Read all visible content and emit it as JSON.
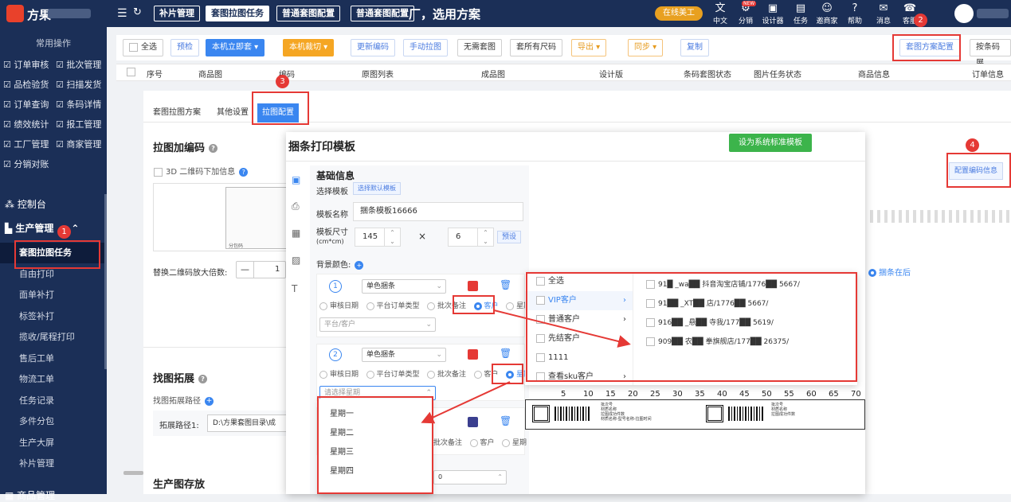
{
  "topbar": {
    "brand": "方果",
    "tabs": [
      "补片管理",
      "套图拉图任务",
      "普通套图配置",
      "普通套图配置"
    ],
    "title": "厂，选用方案",
    "vip": "在线美工",
    "icons": [
      {
        "name": "translate-icon",
        "label": "中文"
      },
      {
        "name": "share-icon",
        "label": "分销"
      },
      {
        "name": "designer-icon",
        "label": "设计器"
      },
      {
        "name": "task-icon",
        "label": "任务"
      },
      {
        "name": "invite-icon",
        "label": "邀商家"
      },
      {
        "name": "help-icon",
        "label": "帮助"
      },
      {
        "name": "message-icon",
        "label": "消息"
      },
      {
        "name": "service-icon",
        "label": "客服"
      }
    ],
    "new_badge": "NEW"
  },
  "sidebar": {
    "head": "常用操作",
    "ops": [
      [
        "订单审核",
        "批次管理"
      ],
      [
        "品检验货",
        "扫描发货"
      ],
      [
        "订单查询",
        "条码详情"
      ],
      [
        "绩效统计",
        "报工管理"
      ],
      [
        "工厂管理",
        "商家管理"
      ],
      [
        "分销对账",
        ""
      ]
    ],
    "console": "控制台",
    "prod": "生产管理",
    "items": [
      "套图拉图任务",
      "自由打印",
      "面单补打",
      "标签补打",
      "揽收/尾程打印",
      "售后工单",
      "物流工单",
      "任务记录",
      "多件分包",
      "生产大屏",
      "补片管理"
    ],
    "more": "商品管理"
  },
  "toolbar": {
    "select_all": "全选",
    "buttons": [
      "预检",
      "本机立即套 ▾",
      "本机裁切 ▾",
      "更新编码",
      "手动拉图",
      "无需套图",
      "套所有尺码",
      "导出 ▾",
      "同步 ▾",
      "复制"
    ],
    "scheme": "套图方案配置",
    "barcode": "按条码展"
  },
  "table": {
    "headers": [
      "序号",
      "商品图",
      "编码",
      "原图列表",
      "成品图",
      "设计版",
      "条码套图状态",
      "图片任务状态",
      "商品信息",
      "订单信息"
    ]
  },
  "panel": {
    "tabs": [
      "套图拉图方案",
      "其他设置",
      "拉图配置"
    ],
    "encode_title": "拉图加编码",
    "qr_label": "3D 二维码下加信息",
    "thumb_text": "分包码",
    "zoom_label": "替换二维码放大倍数:",
    "zoom_minus": "—",
    "zoom_value": "1",
    "config_btn": "配置编码信息",
    "bundle_after": "捆条在后",
    "ext_title": "找图拓展",
    "ext_path_label": "找图拓展路径",
    "ext_path1_label": "拓展路径1:",
    "ext_path1_value": "D:\\方果套图目录\\成",
    "store_title": "生产图存放"
  },
  "modal": {
    "title": "捆条打印模板",
    "std_btn": "设为系统标准模板",
    "basic": "基础信息",
    "choose_tpl": "选择模板",
    "choose_default": "选择默认模板",
    "tpl_name_label": "模板名称",
    "tpl_name": "捆条模板16666",
    "size_label": "模板尺寸",
    "size_unit": "(cm*cm)",
    "width": "145",
    "times": "×",
    "height": "6",
    "preset": "预设",
    "bg": "背景颜色:",
    "rows": [
      {
        "num": "1",
        "type": "单色捆条",
        "opts": [
          "审核日期",
          "平台订单类型",
          "批次备注",
          "客户",
          "星期"
        ],
        "selected": "客户",
        "sub": "平台/客户"
      },
      {
        "num": "2",
        "type": "单色捆条",
        "opts": [
          "审核日期",
          "平台订单类型",
          "批次备注",
          "客户",
          "星期"
        ],
        "selected": "星期",
        "sub": "请选择星期"
      }
    ],
    "row3_opts": [
      "批次备注",
      "客户",
      "星期"
    ],
    "weekdays": [
      "星期一",
      "星期二",
      "星期三",
      "星期四"
    ],
    "cats": [
      "全选",
      "VIP客户",
      "普通客户",
      "先结客户",
      "1111",
      "查看sku客户"
    ],
    "customers": [
      "91█ _wa██ 抖音淘宝店铺/1776██ 5667/",
      "91██ _XT██ 店/1776██ 5667/",
      "916██ _悬██ 寺我/177██ 5619/",
      "909██ 农██ 拳旗舰店/177██ 26375/"
    ],
    "ruler": [
      "5",
      "10",
      "15",
      "20",
      "25",
      "30",
      "35",
      "40",
      "45",
      "50",
      "55",
      "60",
      "65",
      "70"
    ],
    "label_lines": [
      "批次号",
      "材质名称",
      "拉图成功件数",
      "材质名称-型号名称-拉图时间"
    ]
  },
  "annotations": [
    "1",
    "2",
    "3",
    "4"
  ],
  "colors": {
    "nav": "#1b2f57",
    "accent": "#3a86f0",
    "red": "#e53935",
    "green": "#3cb44b",
    "orange": "#f5a623"
  }
}
